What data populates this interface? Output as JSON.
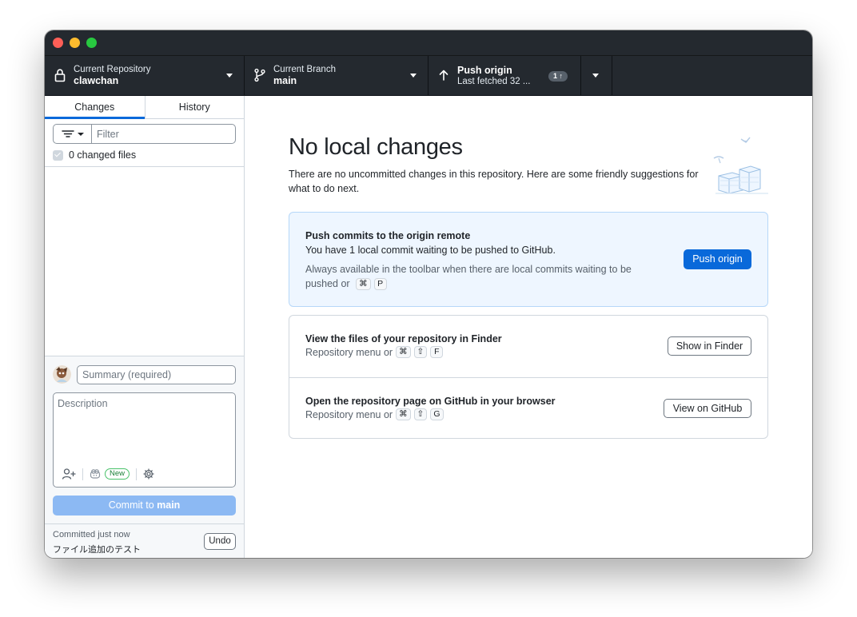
{
  "toolbar": {
    "repository": {
      "label": "Current Repository",
      "value": "clawchan"
    },
    "branch": {
      "label": "Current Branch",
      "value": "main"
    },
    "push": {
      "label": "Push origin",
      "value": "Last fetched 32 ...",
      "badge": "1 ↑"
    }
  },
  "sidebar": {
    "tabs": [
      {
        "label": "Changes",
        "active": true
      },
      {
        "label": "History",
        "active": false
      }
    ],
    "filter_placeholder": "Filter",
    "changed_files_label": "0 changed files",
    "commit": {
      "summary_placeholder": "Summary (required)",
      "description_placeholder": "Description",
      "new_badge": "New",
      "button_prefix": "Commit to ",
      "button_branch": "main"
    },
    "last_commit": {
      "time": "Committed just now",
      "message": "ファイル追加のテスト",
      "undo_label": "Undo"
    }
  },
  "main": {
    "title": "No local changes",
    "description": "There are no uncommitted changes in this repository. Here are some friendly suggestions for what to do next.",
    "push_card": {
      "title": "Push commits to the origin remote",
      "subtitle": "You have 1 local commit waiting to be pushed to GitHub.",
      "hint": "Always available in the toolbar when there are local commits waiting to be pushed or",
      "keys": [
        "⌘",
        "P"
      ],
      "button": "Push origin"
    },
    "finder_card": {
      "title": "View the files of your repository in Finder",
      "hint": "Repository menu or",
      "keys": [
        "⌘",
        "⇧",
        "F"
      ],
      "button": "Show in Finder"
    },
    "github_card": {
      "title": "Open the repository page on GitHub in your browser",
      "hint": "Repository menu or",
      "keys": [
        "⌘",
        "⇧",
        "G"
      ],
      "button": "View on GitHub"
    }
  },
  "icons": {
    "lock": "lock-icon",
    "branch": "git-branch-icon",
    "push": "arrow-up-icon",
    "filter": "filter-icon",
    "coauthor": "person-add-icon",
    "copilot": "copilot-icon",
    "settings": "gear-icon"
  },
  "colors": {
    "toolbar_bg": "#24292f",
    "accent": "#0969da",
    "commit_button_disabled": "#8cb9f3",
    "push_card_bg": "#eef6ff"
  }
}
